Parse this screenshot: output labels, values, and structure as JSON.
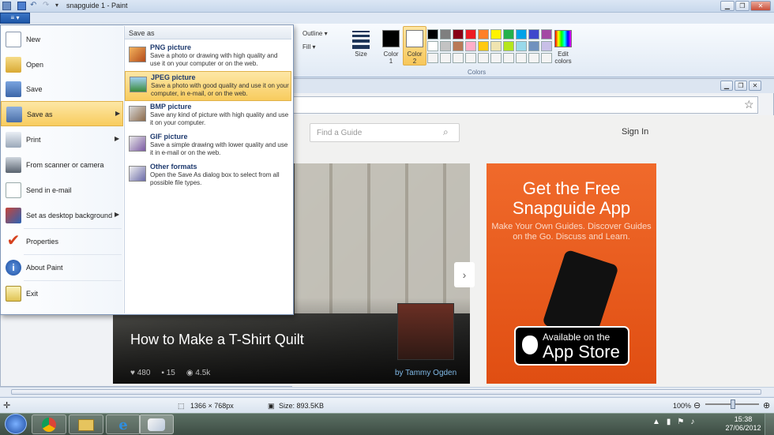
{
  "window": {
    "title": "snapguide 1 - Paint",
    "file_button_label": "≡ ▾"
  },
  "ribbon": {
    "outline_label": "Outline",
    "fill_label": "Fill",
    "size_label": "Size",
    "color1_label": "Color\n1",
    "color2_label": "Color\n2",
    "edit_colors_label": "Edit\ncolors",
    "colors_group_label": "Colors",
    "palette_row1": [
      "#000000",
      "#7f7f7f",
      "#880015",
      "#ed1c24",
      "#ff7f27",
      "#fff200",
      "#22b14c",
      "#00a2e8",
      "#3f48cc",
      "#a349a4"
    ],
    "palette_row2": [
      "#ffffff",
      "#c3c3c3",
      "#b97a57",
      "#ffaec9",
      "#ffc90e",
      "#efe4b0",
      "#b5e61d",
      "#99d9ea",
      "#7092be",
      "#c8bfe7"
    ],
    "palette_row3": [
      "#f4f4f4",
      "#f4f4f4",
      "#f4f4f4",
      "#f4f4f4",
      "#f4f4f4",
      "#f4f4f4",
      "#f4f4f4",
      "#f4f4f4",
      "#f4f4f4",
      "#f4f4f4"
    ]
  },
  "file_menu": {
    "items": [
      {
        "label": "New",
        "icon": "new-file-icon"
      },
      {
        "label": "Open",
        "icon": "open-folder-icon"
      },
      {
        "label": "Save",
        "icon": "save-disk-icon"
      },
      {
        "label": "Save as",
        "icon": "save-as-icon"
      },
      {
        "label": "Print",
        "icon": "printer-icon"
      },
      {
        "label": "From scanner or camera",
        "icon": "scanner-icon"
      },
      {
        "label": "Send in e-mail",
        "icon": "email-icon"
      },
      {
        "label": "Set as desktop background",
        "icon": "desktop-background-icon"
      },
      {
        "label": "Properties",
        "icon": "properties-check-icon"
      },
      {
        "label": "About Paint",
        "icon": "info-icon"
      },
      {
        "label": "Exit",
        "icon": "exit-icon"
      }
    ],
    "save_as": {
      "header": "Save as",
      "options": [
        {
          "title": "PNG picture",
          "desc": "Save a photo or drawing with high quality and use it on your computer or on the web."
        },
        {
          "title": "JPEG picture",
          "desc": "Save a photo with good quality and use it on your computer, in e-mail, or on the web."
        },
        {
          "title": "BMP picture",
          "desc": "Save any kind of picture with high quality and use it on your computer."
        },
        {
          "title": "GIF picture",
          "desc": "Save a simple drawing with lower quality and use it in e-mail or on the web."
        },
        {
          "title": "Other formats",
          "desc": "Open the Save As dialog box to select from all possible file types."
        }
      ]
    }
  },
  "website": {
    "search_placeholder": "Find a Guide",
    "signin_label": "Sign In",
    "hero_title": "How to Make a T-Shirt Quilt",
    "likes": "480",
    "comments": "15",
    "views": "4.5k",
    "author": "by Tammy Ogden",
    "promo_title": "Get the Free Snapguide App",
    "promo_sub": "Make Your Own Guides. Discover Guides on the Go. Discuss and Learn.",
    "appstore_line1": "Available on the",
    "appstore_line2": "App Store"
  },
  "statusbar": {
    "dimensions": "1366 × 768px",
    "size": "Size: 893.5KB",
    "zoom": "100%"
  },
  "taskbar": {
    "time": "15:38",
    "date": "27/06/2012"
  }
}
